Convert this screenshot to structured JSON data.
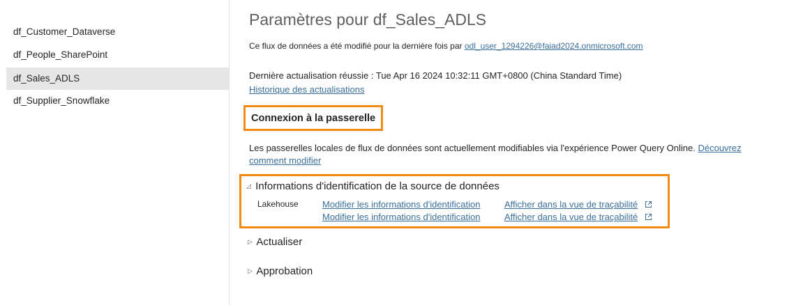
{
  "sidebar": {
    "items": [
      {
        "label": "df_Customer_Dataverse"
      },
      {
        "label": "df_People_SharePoint"
      },
      {
        "label": "df_Sales_ADLS"
      },
      {
        "label": "df_Supplier_Snowflake"
      }
    ]
  },
  "main": {
    "title": "Paramètres pour df_Sales_ADLS",
    "modified_text": "Ce flux de données a été modifié pour la dernière fois par",
    "modified_user": "odl_user_1294226@faiad2024.onmicrosoft.com",
    "last_refresh": "Dernière actualisation réussie : Tue Apr 16 2024 10:32:11 GMT+0800 (China Standard Time)",
    "refresh_history_link": "Historique des actualisations",
    "gateway": {
      "heading": "Connexion à la passerelle",
      "description": "Les passerelles locales de flux de données sont actuellement modifiables via l'expérience Power Query Online.",
      "learn_link_part1": "Découvrez",
      "learn_link_part2": "comment modifier"
    },
    "credentials": {
      "header": "Informations d'identification de la source de données",
      "source_name": "Lakehouse",
      "rows": [
        {
          "edit": "Modifier les informations d'identification",
          "view": "Afficher dans la vue de traçabilité"
        },
        {
          "edit": "Modifier les informations d'identification",
          "view": "Afficher dans la vue de traçabilité"
        }
      ]
    },
    "refresh_section": "Actualiser",
    "approval_section": "Approbation"
  },
  "colors": {
    "highlight": "#f08a12",
    "link": "#3a6f9c",
    "selected_bg": "#e6e6e6"
  }
}
